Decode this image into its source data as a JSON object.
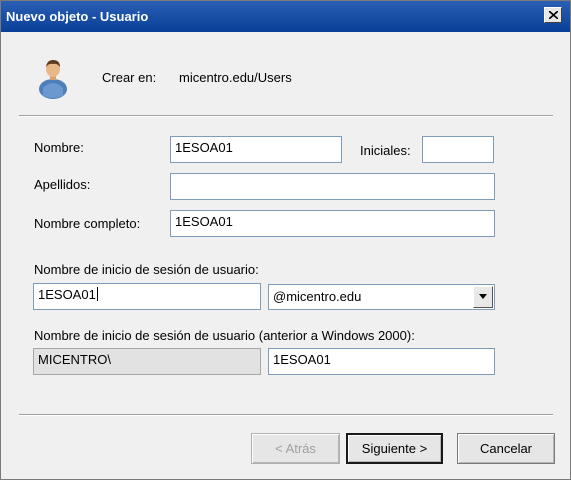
{
  "window": {
    "title": "Nuevo objeto - Usuario"
  },
  "header": {
    "create_in_label": "Crear en:",
    "create_in_value": "micentro.edu/Users"
  },
  "form": {
    "first_name": {
      "label": "Nombre:",
      "value": "1ESOA01"
    },
    "initials": {
      "label": "Iniciales:",
      "value": ""
    },
    "last_name": {
      "label": "Apellidos:",
      "value": ""
    },
    "full_name": {
      "label": "Nombre completo:",
      "value": "1ESOA01"
    },
    "logon_name": {
      "label": "Nombre de inicio de sesión de usuario:",
      "value": "1ESOA01",
      "domain_selected": "@micentro.edu"
    },
    "pre2000_logon": {
      "label": "Nombre de inicio de sesión de usuario (anterior a Windows 2000):",
      "domain_prefix": "MICENTRO\\",
      "value": "1ESOA01"
    }
  },
  "buttons": {
    "back": "< Atrás",
    "next": "Siguiente >",
    "cancel": "Cancelar"
  },
  "icons": {
    "close": "close-icon",
    "user": "user-icon",
    "dropdown": "chevron-down-icon"
  }
}
